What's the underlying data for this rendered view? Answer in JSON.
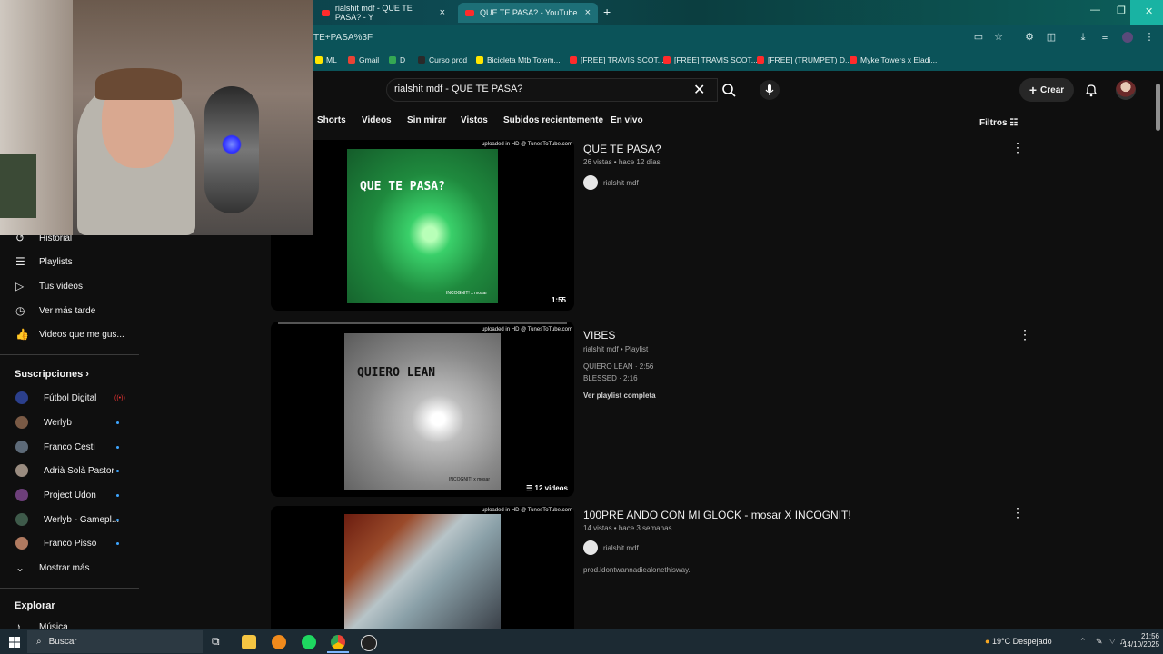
{
  "tabs": [
    {
      "title": "rialshit mdf - QUE TE PASA? - Y"
    },
    {
      "title": "QUE TE PASA? - YouTube"
    }
  ],
  "address": "TE+PASA%3F",
  "bookmarks": [
    "ML",
    "Gmail",
    "D",
    "Curso prod",
    "Bicicleta Mtb Totem...",
    "[FREE] TRAVIS SCOT...",
    "[FREE] TRAVIS SCOT...",
    "[FREE] (TRUMPET) D...",
    "Myke Towers x Eladi..."
  ],
  "header": {
    "search_query": "rialshit mdf - QUE TE PASA?",
    "create_label": "Crear"
  },
  "chips": [
    "Shorts",
    "Videos",
    "Sin mirar",
    "Vistos",
    "Subidos recientemente",
    "En vivo"
  ],
  "filters_label": "Filtros",
  "sidebar": {
    "you_items": [
      {
        "label": "Historial",
        "icon": "history-icon"
      },
      {
        "label": "Playlists",
        "icon": "playlists-icon"
      },
      {
        "label": "Tus videos",
        "icon": "your-videos-icon"
      },
      {
        "label": "Ver más tarde",
        "icon": "watch-later-icon"
      },
      {
        "label": "Videos que me gus...",
        "icon": "liked-videos-icon"
      }
    ],
    "subscriptions_title": "Suscripciones",
    "subscriptions": [
      {
        "label": "Fútbol Digital",
        "color": "#2b3f8c"
      },
      {
        "label": "Werlyb",
        "color": "#7a5a45"
      },
      {
        "label": "Franco Cesti",
        "color": "#5d6a78"
      },
      {
        "label": "Adrià Solà Pastor",
        "color": "#9a8c80"
      },
      {
        "label": "Project Udon",
        "color": "#6d3f7a"
      },
      {
        "label": "Werlyb - Gamepl...",
        "color": "#3e5a4a"
      },
      {
        "label": "Franco Pisso",
        "color": "#b07a60"
      }
    ],
    "show_more": "Mostrar más",
    "explore_title": "Explorar",
    "explore_items": [
      {
        "label": "Música",
        "icon": "music-icon"
      }
    ]
  },
  "results": [
    {
      "title": "QUE TE PASA?",
      "meta": "26 vistas • hace 12 días",
      "channel": "rialshit mdf",
      "duration": "1:55",
      "uploaded": "uploaded in HD @ TunesToTube.com",
      "art_text": "QUE TE PASA?",
      "art_sub": "INCOGNIT! x mosar"
    },
    {
      "title": "VIBES",
      "meta": "rialshit mdf • Playlist",
      "line1": "QUIERO LEAN · 2:56",
      "line2": "BLESSED · 2:16",
      "link": "Ver playlist completa",
      "count": "12 videos",
      "uploaded": "uploaded in HD @ TunesToTube.com",
      "art_text": "QUIERO LEAN",
      "art_sub": "INCOGNIT! x mosar"
    },
    {
      "title": "100PRE ANDO CON MI GLOCK - mosar X INCOGNIT!",
      "meta": "14 vistas • hace 3 semanas",
      "channel": "rialshit mdf",
      "desc": "prod.ldontwannadiealonethisway.",
      "uploaded": "uploaded in HD @ TunesToTube.com"
    }
  ],
  "taskbar": {
    "search_label": "Buscar",
    "weather": "19°C  Despejado",
    "time": "21:56",
    "date": "14/10/2025"
  }
}
